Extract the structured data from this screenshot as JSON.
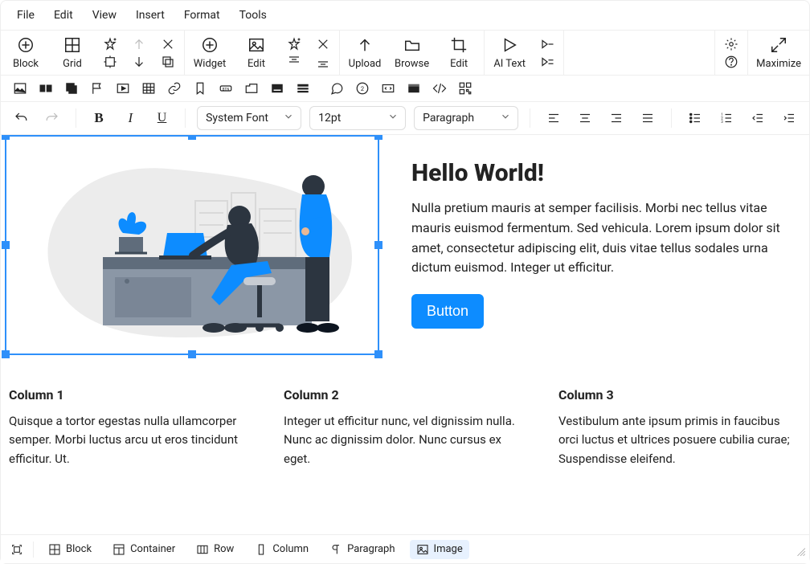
{
  "menu": {
    "file": "File",
    "edit": "Edit",
    "view": "View",
    "insert": "Insert",
    "format": "Format",
    "tools": "Tools"
  },
  "toolbar": {
    "block": "Block",
    "grid": "Grid",
    "widget": "Widget",
    "edit": "Edit",
    "upload": "Upload",
    "browse": "Browse",
    "edit2": "Edit",
    "aitext": "AI Text",
    "maximize": "Maximize"
  },
  "format": {
    "font": "System Font",
    "size": "12pt",
    "style": "Paragraph"
  },
  "hero": {
    "title": "Hello World!",
    "body": "Nulla pretium mauris at semper facilisis. Morbi nec tellus vitae mauris euismod fermentum. Sed vehicula. Lorem ipsum dolor sit amet, consectetur adipiscing elit, duis vitae tellus sodales urna dictum euismod. Integer ut efficitur.",
    "button": "Button"
  },
  "columns": [
    {
      "title": "Column 1",
      "body": "Quisque a tortor egestas nulla ullamcorper semper. Morbi luctus arcu ut eros tincidunt efficitur. Ut."
    },
    {
      "title": "Column 2",
      "body": "Integer ut efficitur nunc, vel dignissim nulla. Nunc ac dignissim dolor. Nunc cursus ex eget."
    },
    {
      "title": "Column 3",
      "body": "Vestibulum ante ipsum primis in faucibus orci luctus et ultrices posuere cubilia curae; Suspendisse eleifend."
    }
  ],
  "breadcrumb": {
    "block": "Block",
    "container": "Container",
    "row": "Row",
    "column": "Column",
    "paragraph": "Paragraph",
    "image": "Image"
  }
}
